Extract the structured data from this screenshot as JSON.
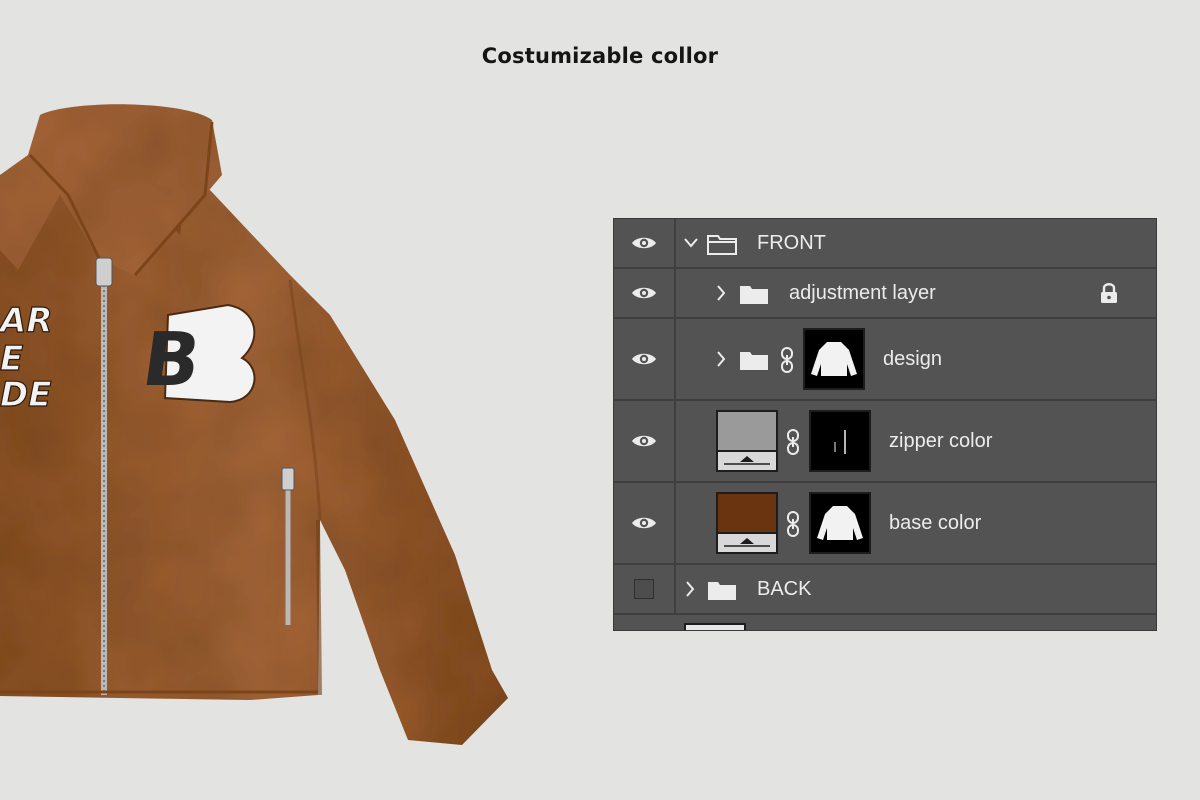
{
  "page": {
    "title": "Costumizable collor"
  },
  "colors": {
    "background": "#e3e3e2",
    "panel": "#535353",
    "jacket": "#a0622f",
    "zipper_swatch": "#9a9a9a",
    "base_swatch": "#6b3410",
    "text": "#ececec"
  },
  "artwork": {
    "patch_letter": "B",
    "side_text": [
      "AR",
      "E",
      "DE"
    ]
  },
  "layers": [
    {
      "name": "FRONT",
      "visible": true,
      "expanded": true,
      "type": "group"
    },
    {
      "name": "adjustment layer",
      "visible": true,
      "type": "group",
      "locked": true
    },
    {
      "name": "design",
      "visible": true,
      "type": "group",
      "has_mask": true
    },
    {
      "name": "zipper color",
      "visible": true,
      "type": "fill",
      "has_mask": true
    },
    {
      "name": "base color",
      "visible": true,
      "type": "fill",
      "has_mask": true
    },
    {
      "name": "BACK",
      "visible": false,
      "expanded": false,
      "type": "group"
    }
  ],
  "icons": [
    "eye-icon",
    "chevron-icon",
    "folder-icon",
    "lock-icon",
    "link-icon"
  ]
}
